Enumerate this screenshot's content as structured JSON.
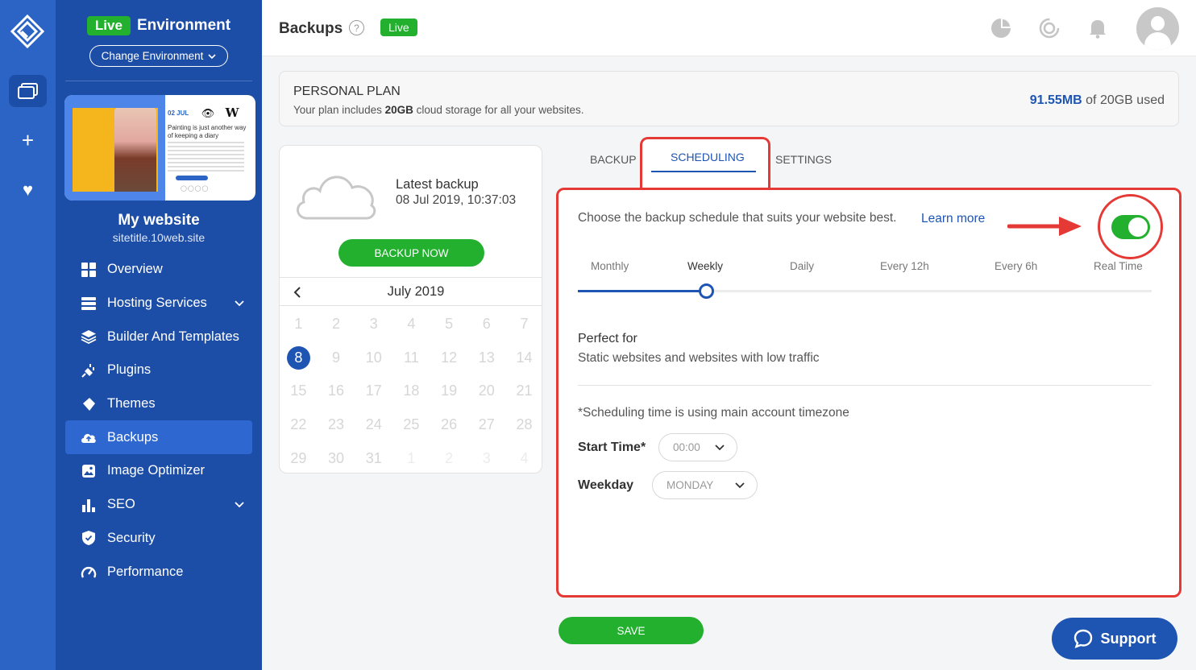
{
  "rail": {
    "items": [
      {
        "icon": "logo-icon"
      },
      {
        "icon": "websites-icon"
      },
      {
        "icon": "add-icon",
        "glyph": "+"
      },
      {
        "icon": "heart-icon",
        "glyph": "♥"
      }
    ]
  },
  "sidebar": {
    "env_badge": "Live",
    "env_label": "Environment",
    "change_env": "Change Environment",
    "preview": {
      "date": "02 JUL",
      "headline": "Painting is just another way of keeping a diary"
    },
    "site_name": "My website",
    "site_url": "sitetitle.10web.site",
    "items": [
      {
        "label": "Overview",
        "icon": "grid-icon"
      },
      {
        "label": "Hosting Services",
        "icon": "server-icon",
        "expandable": true
      },
      {
        "label": "Builder And Templates",
        "icon": "layers-icon"
      },
      {
        "label": "Plugins",
        "icon": "plug-icon"
      },
      {
        "label": "Themes",
        "icon": "brush-icon"
      },
      {
        "label": "Backups",
        "icon": "cloud-upload-icon",
        "active": true
      },
      {
        "label": "Image Optimizer",
        "icon": "image-icon"
      },
      {
        "label": "SEO",
        "icon": "bar-chart-icon",
        "expandable": true
      },
      {
        "label": "Security",
        "icon": "shield-icon"
      },
      {
        "label": "Performance",
        "icon": "gauge-icon"
      }
    ]
  },
  "header": {
    "title": "Backups",
    "live_badge": "Live",
    "icons": [
      "pie-chart-icon",
      "loading-icon",
      "bell-icon",
      "avatar"
    ]
  },
  "plan": {
    "title": "PERSONAL PLAN",
    "desc_prefix": "Your plan includes ",
    "desc_bold": "20GB",
    "desc_suffix": " cloud storage for all your websites.",
    "used_amount": "91.55MB",
    "used_suffix": " of 20GB used"
  },
  "backup_card": {
    "title": "Latest backup",
    "date": "08 Jul 2019, 10:37:03",
    "button": "BACKUP NOW",
    "calendar": {
      "month": "July 2019",
      "selected": 8,
      "weeks": [
        [
          "1",
          "2",
          "3",
          "4",
          "5",
          "6",
          "7"
        ],
        [
          "8",
          "9",
          "10",
          "11",
          "12",
          "13",
          "14"
        ],
        [
          "15",
          "16",
          "17",
          "18",
          "19",
          "20",
          "21"
        ],
        [
          "22",
          "23",
          "24",
          "25",
          "26",
          "27",
          "28"
        ],
        [
          "29",
          "30",
          "31",
          "1",
          "2",
          "3",
          "4"
        ]
      ]
    }
  },
  "tabs": [
    "BACKUP",
    "SCHEDULING",
    "SETTINGS"
  ],
  "active_tab": "SCHEDULING",
  "schedule": {
    "description": "Choose the backup schedule that suits your website best.",
    "learn_more": "Learn more",
    "real_time_enabled": true,
    "frequencies": [
      "Monthly",
      "Weekly",
      "Daily",
      "Every 12h",
      "Every 6h",
      "Real Time"
    ],
    "selected_frequency": "Weekly",
    "perfect_for_title": "Perfect for",
    "perfect_for_desc": "Static websites and websites with low traffic",
    "timezone_note": "*Scheduling time is using main account timezone",
    "start_time_label": "Start Time*",
    "start_time_value": "00:00",
    "weekday_label": "Weekday",
    "weekday_value": "MONDAY"
  },
  "save_button": "SAVE",
  "support_button": "Support",
  "colors": {
    "sidebar": "#1d4ea7",
    "rail": "#2b64c4",
    "accent": "#1e55b3",
    "green": "#22b02e",
    "highlight": "#e53935"
  }
}
